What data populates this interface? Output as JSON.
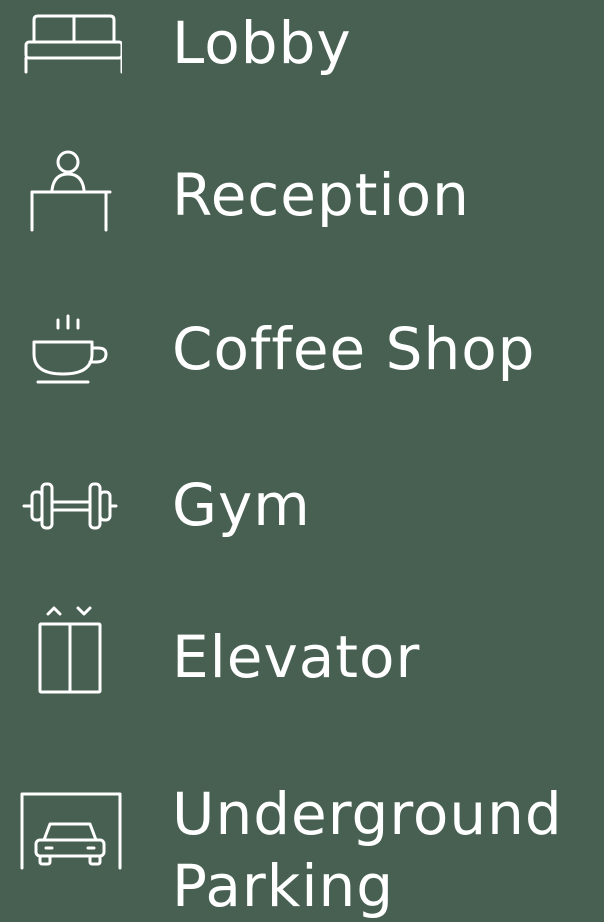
{
  "colors": {
    "background": "#476052",
    "foreground": "#ffffff"
  },
  "amenities": [
    {
      "label": "Lobby",
      "icon": "sofa-icon"
    },
    {
      "label": "Reception",
      "icon": "reception-desk-icon"
    },
    {
      "label": "Coffee Shop",
      "icon": "coffee-cup-icon"
    },
    {
      "label": "Gym",
      "icon": "dumbbell-icon"
    },
    {
      "label": "Elevator",
      "icon": "elevator-icon"
    },
    {
      "label": "Underground Parking",
      "icon": "garage-car-icon"
    }
  ]
}
